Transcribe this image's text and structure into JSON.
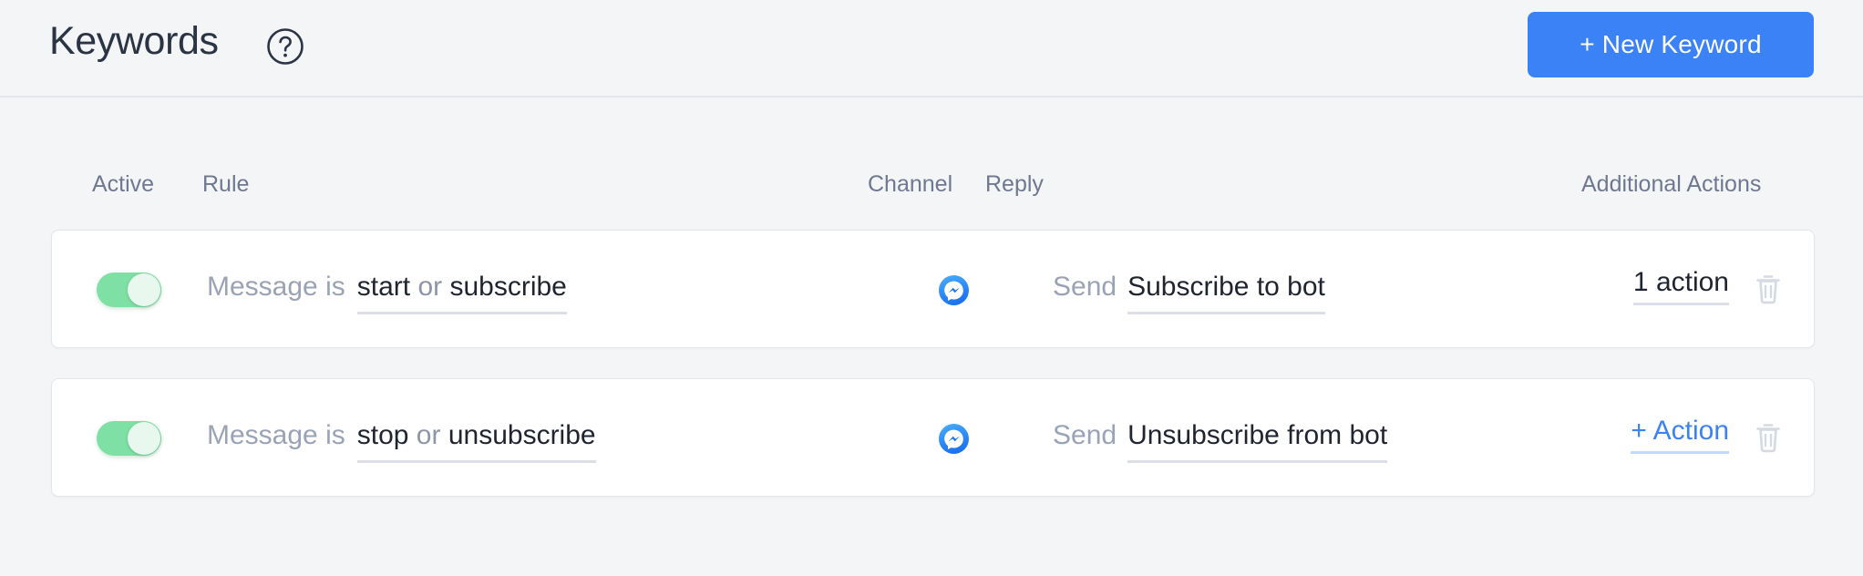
{
  "header": {
    "title": "Keywords",
    "help_icon": "question-mark-circle-icon",
    "new_keyword_label": "+ New Keyword",
    "accent_color": "#3b82f6",
    "background_color": "#f4f5f7"
  },
  "table": {
    "columns": {
      "active": "Active",
      "rule": "Rule",
      "channel": "Channel",
      "reply": "Reply",
      "additional_actions": "Additional Actions"
    },
    "rows": [
      {
        "active": true,
        "toggle_color": "#7ee0a4",
        "rule_prefix": "Message is",
        "rule_value_1": "start",
        "rule_separator": "or",
        "rule_value_2": "subscribe",
        "channel_icon": "facebook-messenger-icon",
        "reply_prefix": "Send",
        "reply_value": "Subscribe to bot",
        "action_label": "1 action",
        "action_is_link": false,
        "delete_icon": "trash-icon"
      },
      {
        "active": true,
        "toggle_color": "#7ee0a4",
        "rule_prefix": "Message is",
        "rule_value_1": "stop",
        "rule_separator": "or",
        "rule_value_2": "unsubscribe",
        "channel_icon": "facebook-messenger-icon",
        "reply_prefix": "Send",
        "reply_value": "Unsubscribe from bot",
        "action_label": "+ Action",
        "action_is_link": true,
        "delete_icon": "trash-icon"
      }
    ]
  }
}
